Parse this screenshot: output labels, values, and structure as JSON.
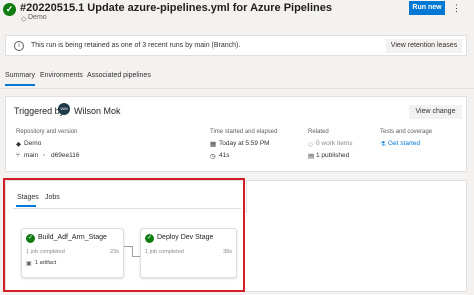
{
  "header": {
    "status_glyph": "✓",
    "title": "#20220515.1 Update azure-pipelines.yml for Azure Pipelines",
    "project_icon": "◇",
    "project": "Demo",
    "run_new_label": "Run new",
    "more_glyph": "⋮"
  },
  "banner": {
    "info_glyph": "i",
    "text": "This run is being retained as one of 3 recent runs by main (Branch).",
    "button_label": "View retention leases"
  },
  "tabs": [
    "Summary",
    "Environments",
    "Associated pipelines"
  ],
  "summary": {
    "triggered_by_label": "Triggered by",
    "avatar_initials": "WM",
    "user": "Wilson Mok",
    "view_change_label": "View change",
    "repo_head": "Repository and version",
    "repo_icon": "◆",
    "repo": "Demo",
    "branch_icon": "⑂",
    "branch": "main",
    "commit_icon": "◦",
    "commit": "d69ee116",
    "time_head": "Time started and elapsed",
    "date_icon": "▦",
    "date": "Today at 5:59 PM",
    "elapsed_icon": "◷",
    "elapsed": "41s",
    "related_head": "Related",
    "work_items_icon": "◇",
    "work_items": "0 work items",
    "published_icon": "▤",
    "published": "1 published",
    "tests_head": "Tests and coverage",
    "tests_icon": "⚗",
    "tests_link": "Get started"
  },
  "stages_panel": {
    "tab_stages": "Stages",
    "tab_jobs": "Jobs",
    "stages": [
      {
        "name": "Build_Adf_Arm_Stage",
        "jobs": "1 job completed",
        "duration": "23s",
        "artifact_icon": "▣",
        "artifact": "1 artifact",
        "status_glyph": "✓"
      },
      {
        "name": "Deploy Dev Stage",
        "jobs": "1 job completed",
        "duration": "38s",
        "status_glyph": "✓"
      }
    ]
  },
  "colors": {
    "accent": "#0078d4",
    "success": "#107c10",
    "highlight": "#d21f26"
  }
}
